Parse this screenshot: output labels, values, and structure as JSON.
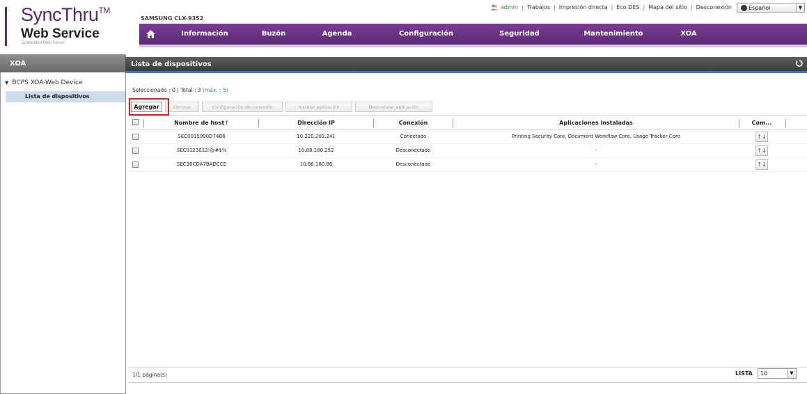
{
  "logo": {
    "title": "SyncThru",
    "tm": "TM",
    "subtitle": "Web Service",
    "tagline": "Embedded Web Server"
  },
  "device_model": "SAMSUNG CLX-9352",
  "util_links": {
    "user": "admin",
    "items": [
      "Trabajos",
      "Impresión directa",
      "Eco DES",
      "Mapa del sitio",
      "Desconexión"
    ]
  },
  "language": {
    "selected": "Español"
  },
  "top_nav": [
    "Información",
    "Buzón",
    "Agenda",
    "Configuración",
    "Seguridad",
    "Mantenimiento",
    "XOA"
  ],
  "sidebar": {
    "title": "XOA",
    "tree_root": "BCPS XOA-Web Device",
    "active_item": "Lista de dispositivos"
  },
  "main": {
    "title": "Lista de dispositivos",
    "selection": {
      "selected_label": "Seleccionado : 0",
      "total_label": "Total : 3",
      "max_label": "(máx. : 5)"
    },
    "buttons": {
      "add": "Agregar",
      "delete": "Eliminar",
      "connection_config": "Configuración de conexión",
      "install_app": "Instalar aplicación",
      "uninstall_app": "Desinstalar aplicación"
    },
    "table": {
      "headers": {
        "host": "Nombre de host",
        "sort_arrow": "↑",
        "ip": "Dirección IP",
        "connection": "Conexión",
        "apps": "Aplicaciones instaladas",
        "actions": "Com..."
      },
      "rows": [
        {
          "host": "SEC0015990D74B6",
          "ip": "10.220.201.241",
          "connection": "Conectado",
          "apps": "Printing Security Core, Document Workflow Core, Usage Tracker Core",
          "action_icon": "↑↓"
        },
        {
          "host": "SEC0123012!@#$%",
          "ip": "10.88.180.252",
          "connection": "Desconectado",
          "apps": "-",
          "action_icon": "↑↓"
        },
        {
          "host": "SEC30CDA7BADCCE",
          "ip": "10.88.180.86",
          "connection": "Desconectado",
          "apps": "-",
          "action_icon": "↑↓"
        }
      ]
    },
    "footer": {
      "pages": "1/1 página(s)",
      "list_label": "LISTA",
      "list_value": "10"
    }
  },
  "colors": {
    "nav_purple": "#6a3284",
    "accent_blue": "#3b79c6",
    "highlight_red": "#e0211d"
  }
}
